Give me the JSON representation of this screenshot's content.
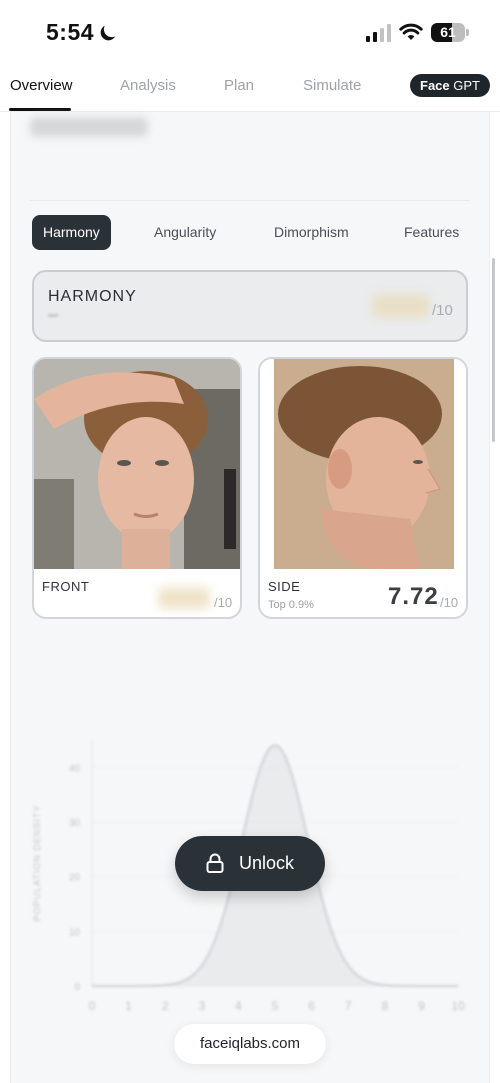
{
  "status_bar": {
    "time": "5:54",
    "battery_level": "61",
    "battery_fraction": 0.61,
    "icons": [
      "moon-icon",
      "signal-icon",
      "wifi-icon",
      "battery-icon"
    ]
  },
  "tabs": [
    {
      "label": "Overview",
      "active": true
    },
    {
      "label": "Analysis",
      "active": false
    },
    {
      "label": "Plan",
      "active": false
    },
    {
      "label": "Simulate",
      "active": false
    }
  ],
  "face_gpt": {
    "bold": "Face",
    "regular": "GPT"
  },
  "categories": [
    {
      "label": "Harmony",
      "active": true
    },
    {
      "label": "Angularity",
      "active": false
    },
    {
      "label": "Dimorphism",
      "active": false
    },
    {
      "label": "Features",
      "active": false
    }
  ],
  "harmony": {
    "label": "HARMONY",
    "of": "/10"
  },
  "front": {
    "label": "FRONT",
    "of": "/10"
  },
  "side": {
    "label": "SIDE",
    "sub": "Top 0.9%",
    "score": "7.72",
    "of": "/10"
  },
  "chart_data": {
    "type": "area",
    "ylabel": "POPULATION DENSITY",
    "x_ticks": [
      "0",
      "1",
      "2",
      "3",
      "4",
      "5",
      "6",
      "7",
      "8",
      "9",
      "10"
    ],
    "y_ticks": [
      "0",
      "10",
      "20",
      "30",
      "40"
    ],
    "xlim": [
      0,
      10
    ],
    "ylim": [
      0,
      45
    ],
    "curve": {
      "shape": "normal",
      "mean": 5,
      "peak": 44,
      "sd": 0.9
    },
    "grid": true
  },
  "unlock": {
    "label": "Unlock"
  },
  "url": "faceiqlabs.com",
  "colors": {
    "accent_dark": "#2b3237",
    "background": "#f6f7f8"
  }
}
